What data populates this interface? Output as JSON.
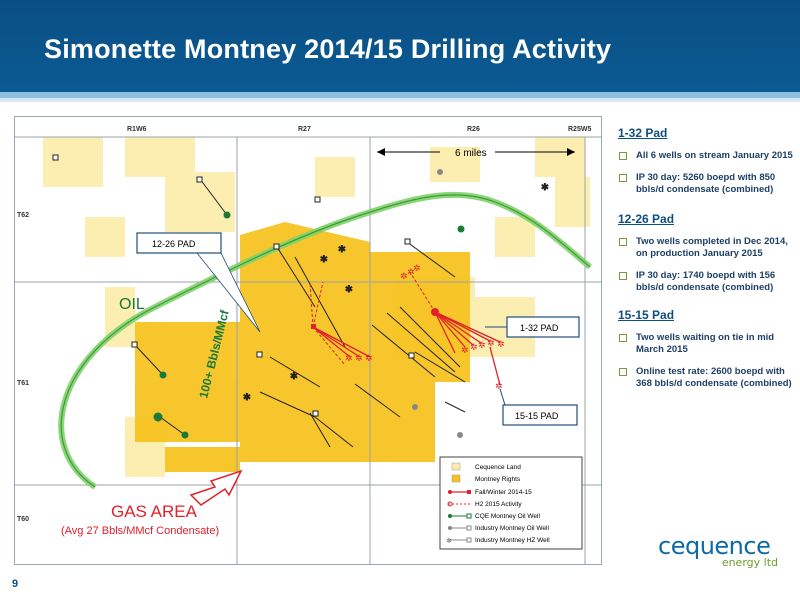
{
  "slide": {
    "title": "Simonette Montney 2014/15 Drilling Activity",
    "page_number": "9"
  },
  "map": {
    "grid_labels": {
      "ranges": [
        "R1W6",
        "R27",
        "R26",
        "R25W5"
      ],
      "townships": [
        "T62",
        "T61",
        "T60"
      ]
    },
    "scale_label": "6 miles",
    "region_labels": {
      "oil": "OIL",
      "rate": "100+ Bbls/MMcf",
      "gas": "GAS AREA",
      "gas_sub": "(Avg 27 Bbls/MMcf Condensate)"
    },
    "callouts": [
      "12-26 PAD",
      "1-32 PAD",
      "15-15 PAD"
    ],
    "legend": [
      {
        "label": "Cequence Land",
        "symbol": "land"
      },
      {
        "label": "Montney Rights",
        "symbol": "rights"
      },
      {
        "label": "Fall/Winter 2014-15",
        "symbol": "fall-winter"
      },
      {
        "label": "H2 2015 Activity",
        "symbol": "h2-activity"
      },
      {
        "label": "CQE Montney Oil Well",
        "symbol": "cqe-oil"
      },
      {
        "label": "Industry Montney Oil Well",
        "symbol": "industry-oil"
      },
      {
        "label": "Industry Montney HZ Well",
        "symbol": "industry-hz"
      }
    ],
    "colors": {
      "cequence_land": "#fbeeb0",
      "montney_rights": "#f7c21c",
      "oil_gas_boundary": "#7fd16a",
      "red_activity": "#e0202a",
      "callout_blue": "#1f4e79"
    }
  },
  "sidebar": {
    "pads": [
      {
        "title": "1-32 Pad",
        "bullets": [
          "All 6 wells on stream January 2015",
          "IP 30 day: 5260 boepd with 850 bbls/d condensate (combined)"
        ]
      },
      {
        "title": "12-26 Pad",
        "bullets": [
          "Two wells completed in Dec 2014, on production January 2015",
          "IP 30 day: 1740 boepd with 156 bbls/d condensate (combined)"
        ]
      },
      {
        "title": "15-15 Pad",
        "bullets": [
          "Two wells waiting on tie in mid March 2015",
          "Online test rate: 2600 boepd with 368 bbls/d condensate (combined)"
        ]
      }
    ]
  },
  "logo": {
    "name": "cequence",
    "tagline": "energy ltd"
  }
}
